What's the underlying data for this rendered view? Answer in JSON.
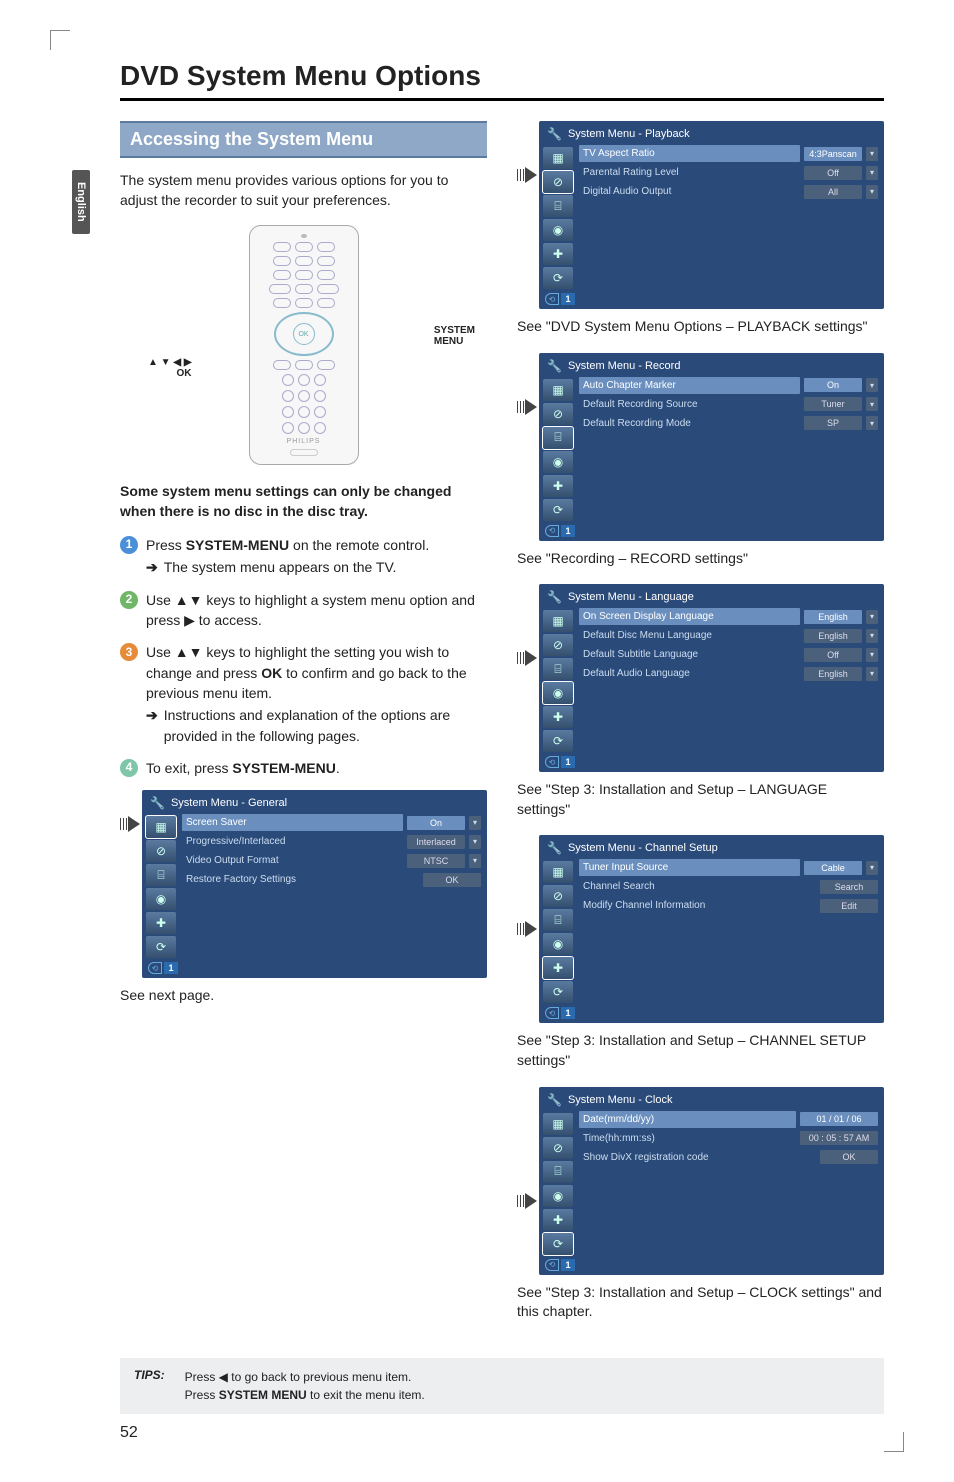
{
  "page": {
    "number": "52",
    "lang_tab": "English",
    "title": "DVD System Menu Options"
  },
  "section": {
    "heading": "Accessing the System Menu",
    "intro": "The system menu provides various options for you to adjust the recorder to suit your preferences.",
    "remote_callout_left_line1": "▲ ▼ ◀ ▶",
    "remote_callout_left_line2": "OK",
    "remote_callout_right_line1": "SYSTEM",
    "remote_callout_right_line2": "MENU",
    "remote_brand": "PHILIPS",
    "bold_note": "Some system menu settings can only be changed when there is no disc in the disc tray.",
    "steps": {
      "1": {
        "text_a": "Press ",
        "text_b": "SYSTEM-MENU",
        "text_c": " on the remote control.",
        "sub": "The system menu appears on the TV."
      },
      "2": {
        "text_a": "Use ▲▼ keys to highlight a system menu option and press ▶ to access."
      },
      "3": {
        "text_a": "Use ▲▼ keys to highlight the setting you wish to change and press ",
        "text_b": "OK",
        "text_c": " to confirm and go back to the previous menu item.",
        "sub": "Instructions and explanation of the options are provided in the following pages."
      },
      "4": {
        "text_a": "To exit, press ",
        "text_b": "SYSTEM-MENU",
        "text_c": "."
      }
    },
    "see_next": "See next page."
  },
  "tips": {
    "label": "TIPS:",
    "line1a": "Press ◀ to go back to previous menu item.",
    "line2a": "Press ",
    "line2b": "SYSTEM MENU",
    "line2c": " to exit the menu item."
  },
  "menus": {
    "icons": [
      "▦",
      "⊘",
      "⌸",
      "◉",
      "✚",
      "⟳"
    ],
    "page_indicator": "1",
    "general": {
      "title": "System Menu - General",
      "active_icon": 0,
      "rows": [
        {
          "label": "Screen Saver",
          "value": "On",
          "drop": true,
          "sel": true
        },
        {
          "label": "Progressive/Interlaced",
          "value": "Interlaced",
          "drop": true
        },
        {
          "label": "Video Output Format",
          "value": "NTSC",
          "drop": true
        },
        {
          "label": "Restore Factory Settings",
          "value": "OK"
        }
      ],
      "ref": ""
    },
    "playback": {
      "title": "System Menu - Playback",
      "active_icon": 1,
      "rows": [
        {
          "label": "TV Aspect Ratio",
          "value": "4:3Panscan",
          "drop": true,
          "sel": true
        },
        {
          "label": "Parental Rating Level",
          "value": "Off",
          "drop": true
        },
        {
          "label": "Digital Audio Output",
          "value": "All",
          "drop": true
        }
      ],
      "ref": "See \"DVD System Menu Options – PLAYBACK settings\""
    },
    "record": {
      "title": "System Menu - Record",
      "active_icon": 2,
      "rows": [
        {
          "label": "Auto Chapter Marker",
          "value": "On",
          "drop": true,
          "sel": true
        },
        {
          "label": "Default Recording Source",
          "value": "Tuner",
          "drop": true
        },
        {
          "label": "Default Recording Mode",
          "value": "SP",
          "drop": true
        }
      ],
      "ref": "See \"Recording – RECORD settings\""
    },
    "language": {
      "title": "System Menu - Language",
      "active_icon": 3,
      "rows": [
        {
          "label": "On Screen Display Language",
          "value": "English",
          "drop": true,
          "sel": true
        },
        {
          "label": "Default Disc Menu Language",
          "value": "English",
          "drop": true
        },
        {
          "label": "Default Subtitle Language",
          "value": "Off",
          "drop": true
        },
        {
          "label": "Default Audio Language",
          "value": "English",
          "drop": true
        }
      ],
      "ref": "See \"Step 3: Installation and Setup – LANGUAGE settings\""
    },
    "channel": {
      "title": "System Menu - Channel Setup",
      "active_icon": 4,
      "rows": [
        {
          "label": "Tuner Input Source",
          "value": "Cable",
          "drop": true,
          "sel": true
        },
        {
          "label": "Channel Search",
          "value": "Search"
        },
        {
          "label": "Modify Channel Information",
          "value": "Edit"
        }
      ],
      "ref": "See \"Step 3: Installation and Setup – CHANNEL SETUP settings\""
    },
    "clock": {
      "title": "System Menu - Clock",
      "active_icon": 5,
      "rows": [
        {
          "label": "Date(mm/dd/yy)",
          "value": "01 / 01 / 06",
          "sel": true,
          "wide": true
        },
        {
          "label": "Time(hh:mm:ss)",
          "value": "00 : 05 : 57 AM",
          "wide": true
        },
        {
          "label": "Show DivX registration code",
          "value": "OK"
        }
      ],
      "ref": "See \"Step 3: Installation and Setup – CLOCK settings\" and this chapter."
    }
  }
}
